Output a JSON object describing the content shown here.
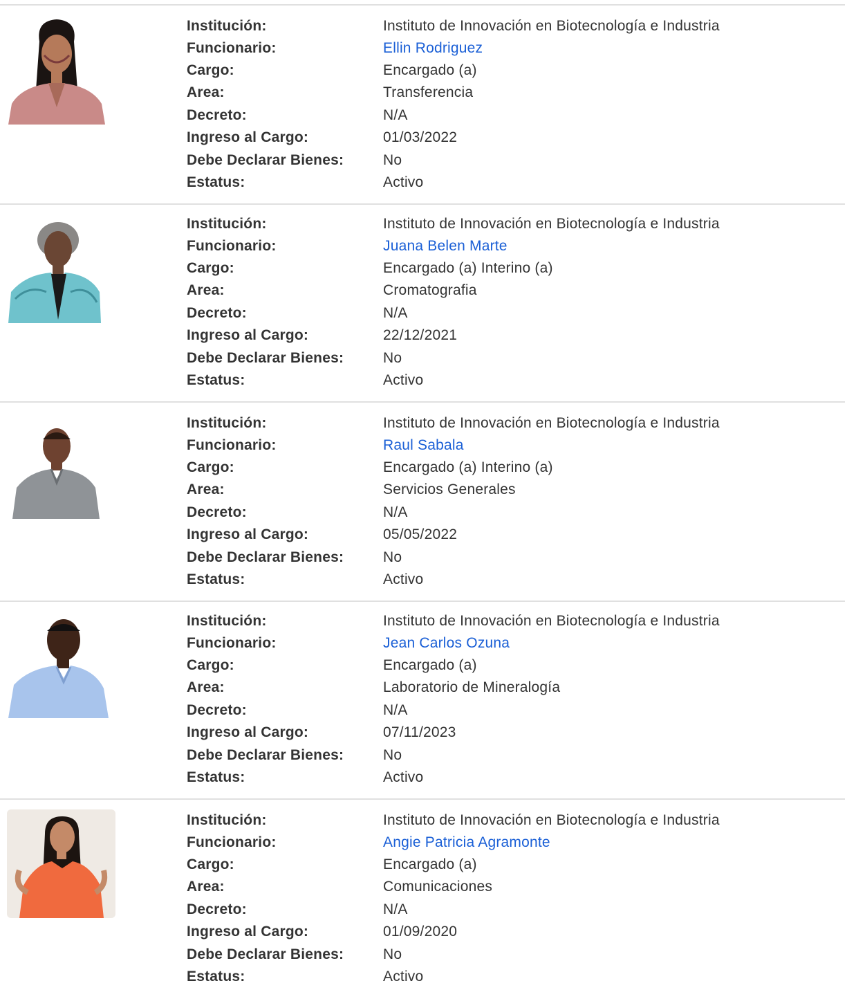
{
  "colors": {
    "link": "#1a5fd6",
    "text": "#333333",
    "divider": "#e0e0e0"
  },
  "labels": {
    "institucion": "Institución:",
    "funcionario": "Funcionario:",
    "cargo": "Cargo:",
    "area": "Area:",
    "decreto": "Decreto:",
    "ingreso": "Ingreso al Cargo:",
    "debe_declarar": "Debe Declarar Bienes:",
    "estatus": "Estatus:"
  },
  "records": [
    {
      "institucion": "Instituto de Innovación en Biotecnología e Industria",
      "funcionario": "Ellin Rodriguez",
      "cargo": "Encargado (a)",
      "area": "Transferencia",
      "decreto": "N/A",
      "ingreso": "01/03/2022",
      "debe_declarar": "No",
      "estatus": "Activo"
    },
    {
      "institucion": "Instituto de Innovación en Biotecnología e Industria",
      "funcionario": "Juana Belen Marte",
      "cargo": "Encargado (a) Interino (a)",
      "area": "Cromatografia",
      "decreto": "N/A",
      "ingreso": "22/12/2021",
      "debe_declarar": "No",
      "estatus": "Activo"
    },
    {
      "institucion": "Instituto de Innovación en Biotecnología e Industria",
      "funcionario": "Raul Sabala",
      "cargo": "Encargado (a) Interino (a)",
      "area": "Servicios Generales",
      "decreto": "N/A",
      "ingreso": "05/05/2022",
      "debe_declarar": "No",
      "estatus": "Activo"
    },
    {
      "institucion": "Instituto de Innovación en Biotecnología e Industria",
      "funcionario": "Jean Carlos Ozuna",
      "cargo": "Encargado (a)",
      "area": "Laboratorio de Mineralogía",
      "decreto": "N/A",
      "ingreso": "07/11/2023",
      "debe_declarar": "No",
      "estatus": "Activo"
    },
    {
      "institucion": "Instituto de Innovación en Biotecnología e Industria",
      "funcionario": "Angie Patricia Agramonte",
      "cargo": "Encargado (a)",
      "area": "Comunicaciones",
      "decreto": "N/A",
      "ingreso": "01/09/2020",
      "debe_declarar": "No",
      "estatus": "Activo"
    }
  ]
}
